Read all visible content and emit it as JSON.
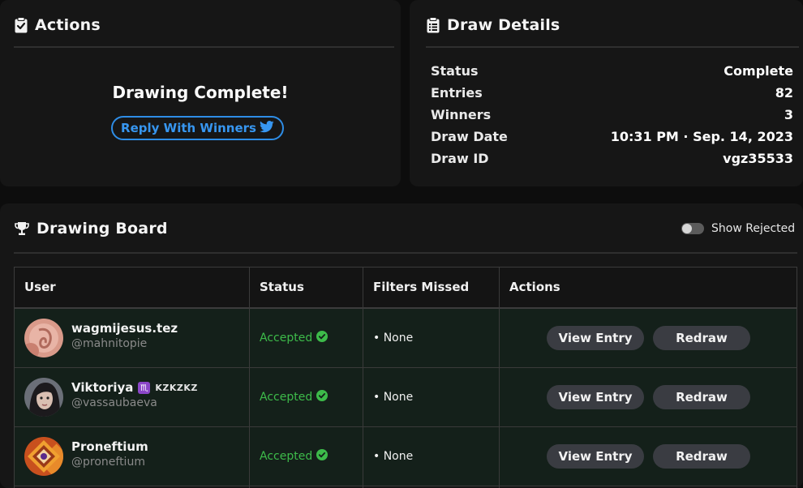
{
  "actions": {
    "title": "Actions",
    "status_message": "Drawing Complete!",
    "reply_button": "Reply With Winners"
  },
  "details": {
    "title": "Draw Details",
    "rows": [
      {
        "label": "Status",
        "value": "Complete"
      },
      {
        "label": "Entries",
        "value": "82"
      },
      {
        "label": "Winners",
        "value": "3"
      },
      {
        "label": "Draw Date",
        "value": "10:31 PM · Sep. 14, 2023"
      },
      {
        "label": "Draw ID",
        "value": "vgz35533"
      }
    ]
  },
  "board": {
    "title": "Drawing Board",
    "show_rejected_label": "Show Rejected",
    "show_rejected_on": false,
    "columns": [
      "User",
      "Status",
      "Filters Missed",
      "Actions"
    ],
    "rows": [
      {
        "name": "wagmijesus.tez",
        "handle": "@mahnitopie",
        "status": "Accepted",
        "filters": "• None",
        "view_label": "View Entry",
        "redraw_label": "Redraw"
      },
      {
        "name": "Viktoriya",
        "name_extra": "KZKZKZ",
        "zodiac": "♏",
        "handle": "@vassaubaeva",
        "status": "Accepted",
        "filters": "• None",
        "view_label": "View Entry",
        "redraw_label": "Redraw"
      },
      {
        "name": "Proneftium",
        "handle": "@proneftium",
        "status": "Accepted",
        "filters": "• None",
        "view_label": "View Entry",
        "redraw_label": "Redraw"
      }
    ]
  },
  "icons": {
    "actions": "clipboard-check-icon",
    "details": "clipboard-list-icon",
    "board": "trophy-icon",
    "reply": "twitter-bird-icon",
    "accepted": "check-circle-icon"
  },
  "colors": {
    "background": "#0d0d0d",
    "card": "#161616",
    "accent_blue": "#2e8de6",
    "accepted_green": "#3dbb4a",
    "row_bg": "#14201a",
    "button_bg": "#3a3c42"
  }
}
